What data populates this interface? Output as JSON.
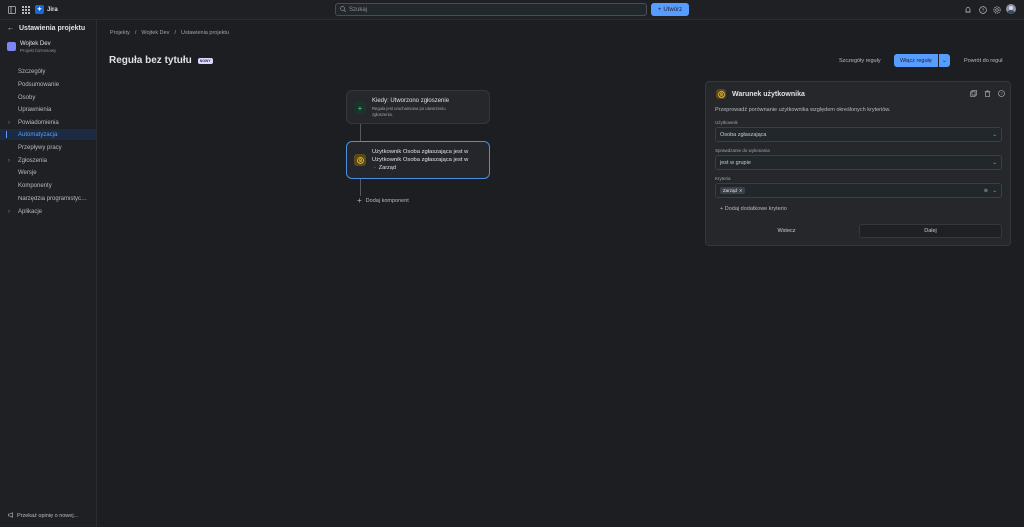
{
  "topnav": {
    "app_name": "Jira",
    "search_placeholder": "Szukaj",
    "create_label": "Utwórz"
  },
  "sidebar": {
    "title": "Ustawienia projektu",
    "project": {
      "name": "Wojtek Dev",
      "subtitle": "Projekt biznesowy"
    },
    "items": [
      {
        "label": "Szczegóły",
        "expandable": false
      },
      {
        "label": "Podsumowanie",
        "expandable": false
      },
      {
        "label": "Osoby",
        "expandable": false
      },
      {
        "label": "Uprawnienia",
        "expandable": false
      },
      {
        "label": "Powiadomienia",
        "expandable": true
      },
      {
        "label": "Automatyzacja",
        "expandable": false,
        "active": true
      },
      {
        "label": "Przepływy pracy",
        "expandable": false
      },
      {
        "label": "Zgłoszenia",
        "expandable": true
      },
      {
        "label": "Wersje",
        "expandable": false
      },
      {
        "label": "Komponenty",
        "expandable": false
      },
      {
        "label": "Narzędzia programistyczne",
        "expandable": false
      },
      {
        "label": "Aplikacje",
        "expandable": true
      }
    ],
    "feedback_label": "Przekaż opinię o nowej..."
  },
  "breadcrumb": [
    "Projekty",
    "Wojtek Dev",
    "Ustawienia projektu"
  ],
  "header": {
    "title": "Reguła bez tytułu",
    "badge": "NOWY",
    "details_label": "Szczegóły reguły",
    "enable_label": "Włącz regułę",
    "return_label": "Powrót do reguł"
  },
  "flow": {
    "trigger": {
      "title": "Kiedy: Utworzono zgłoszenie",
      "desc": "Reguła jest uruchamiana po utworzeniu zgłoszenia."
    },
    "condition": {
      "line1": "Użytkownik Osoba zgłaszająca jest w",
      "line2": "Użytkownik Osoba zgłaszająca jest w",
      "line3": "Zarząd"
    },
    "add_component_label": "Dodaj komponent"
  },
  "panel": {
    "title": "Warunek użytkownika",
    "description": "Przeprowadź porównanie użytkownika względem określonych kryteriów.",
    "user_label": "Użytkownik",
    "user_value": "Osoba zgłaszająca",
    "check_label": "Sprawdzanie do wykonania",
    "check_value": "jest w grupie",
    "criteria_label": "Kryteria",
    "criteria_chip": "Zarząd",
    "add_criteria_label": "+ Dodaj dodatkowe kryterio",
    "back_label": "Wstecz",
    "next_label": "Dalej"
  },
  "colors": {
    "accent": "#579dff",
    "background": "#1d1e21",
    "panel": "#26272b"
  }
}
